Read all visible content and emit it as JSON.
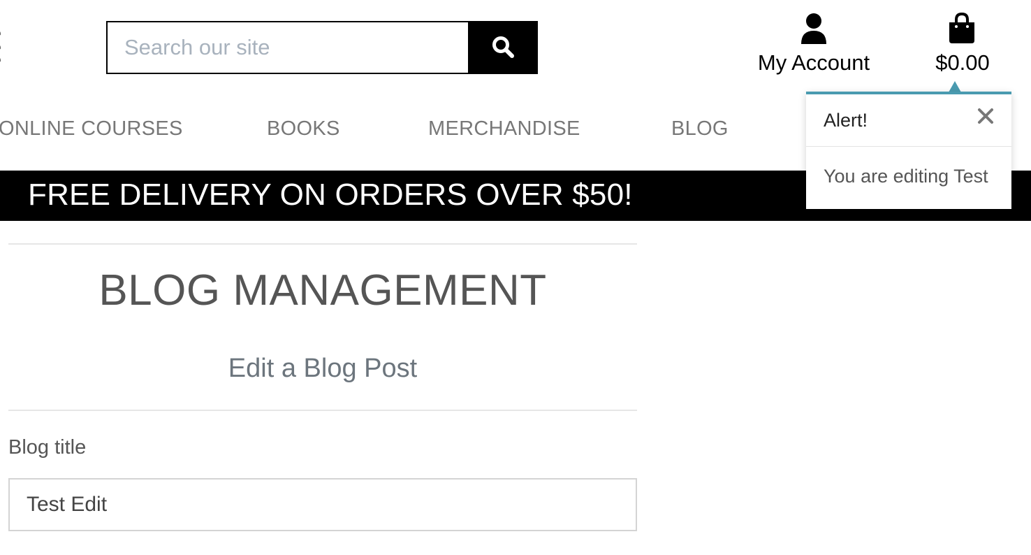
{
  "header": {
    "search": {
      "placeholder": "Search our site",
      "value": "",
      "button_icon": "search-icon"
    },
    "account": {
      "label": "My Account",
      "icon": "user-icon"
    },
    "bag": {
      "total": "$0.00",
      "icon": "shopping-bag-icon"
    }
  },
  "nav": {
    "items": [
      {
        "label": "ONLINE COURSES"
      },
      {
        "label": "BOOKS"
      },
      {
        "label": "MERCHANDISE"
      },
      {
        "label": "BLOG"
      }
    ]
  },
  "banner": {
    "text": "FREE DELIVERY ON ORDERS OVER $50!"
  },
  "toast": {
    "title": "Alert!",
    "message": "You are editing Test",
    "close_icon": "close-icon",
    "accent_color": "#4a9bb0"
  },
  "main": {
    "title": "BLOG MANAGEMENT",
    "subtitle": "Edit a Blog Post",
    "form": {
      "title_label": "Blog title",
      "title_value": "Test Edit"
    }
  },
  "colors": {
    "banner_bg": "#000000",
    "banner_text": "#ffffff",
    "nav_text": "#777777",
    "placeholder": "#a8b2bd"
  }
}
